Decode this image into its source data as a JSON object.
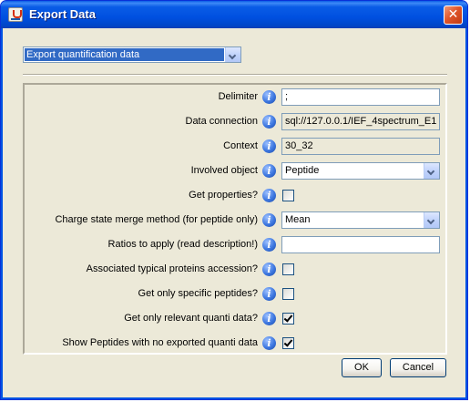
{
  "window": {
    "title": "Export Data",
    "close_glyph": "✕"
  },
  "export_type": {
    "selected": "Export quantification data"
  },
  "rows": [
    {
      "label": "Delimiter",
      "type": "text",
      "value": ";"
    },
    {
      "label": "Data connection",
      "type": "readonly",
      "value": "sql://127.0.0.1/IEF_4spectrum_E1"
    },
    {
      "label": "Context",
      "type": "readonly",
      "value": "30_32"
    },
    {
      "label": "Involved object",
      "type": "combo",
      "value": "Peptide"
    },
    {
      "label": "Get properties?",
      "type": "check",
      "checked": false
    },
    {
      "label": "Charge state merge method (for peptide only)",
      "type": "combo",
      "value": "Mean"
    },
    {
      "label": "Ratios to apply (read description!)",
      "type": "text",
      "value": ""
    },
    {
      "label": "Associated typical proteins accession?",
      "type": "check",
      "checked": false
    },
    {
      "label": "Get only specific peptides?",
      "type": "check",
      "checked": false
    },
    {
      "label": "Get only relevant quanti data?",
      "type": "check",
      "checked": true
    },
    {
      "label": "Show Peptides with no exported quanti data",
      "type": "check",
      "checked": true
    }
  ],
  "info_glyph": "i",
  "buttons": {
    "ok": "OK",
    "cancel": "Cancel"
  }
}
